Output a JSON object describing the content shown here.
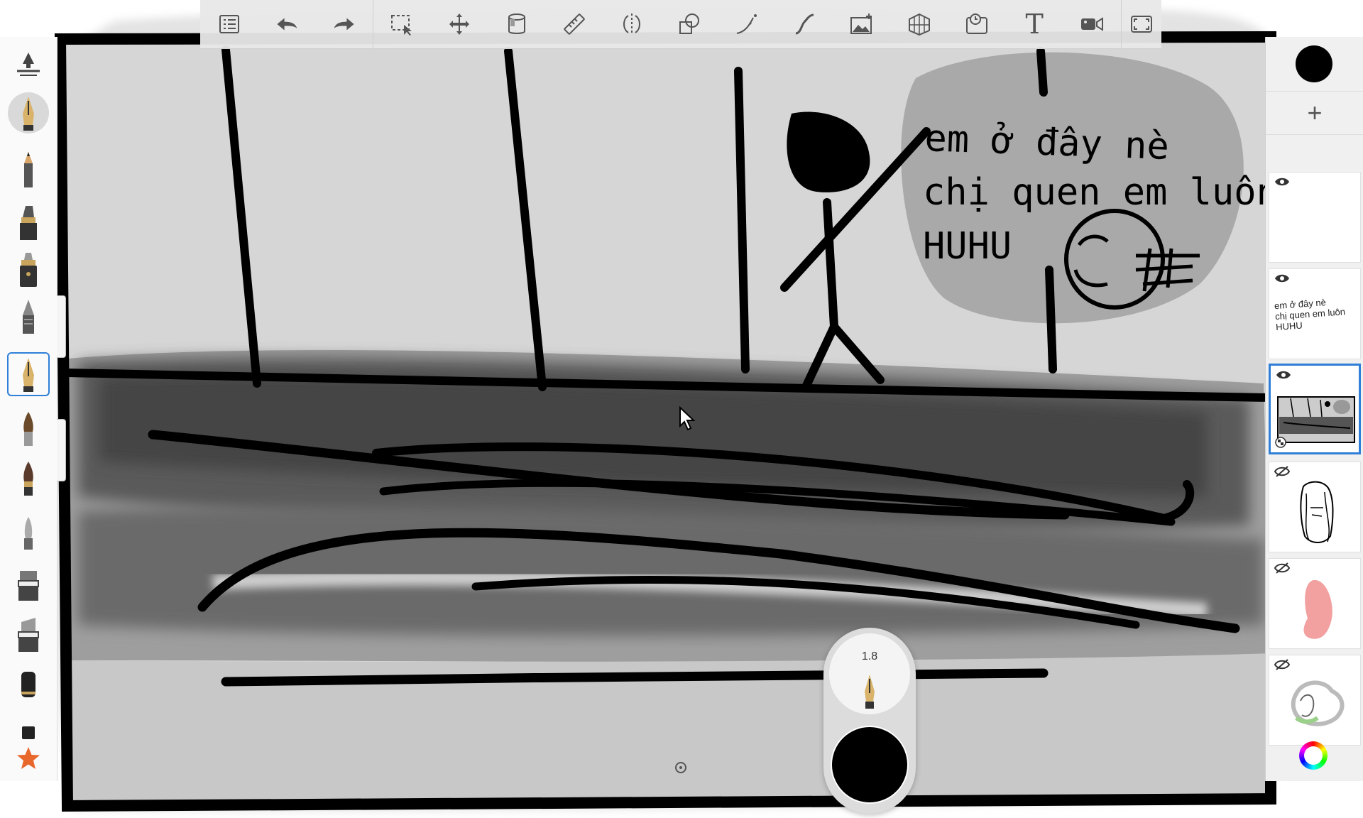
{
  "app": {
    "canvas_text": {
      "line1": "em ở đây nè",
      "line2": "chị quen em luôn",
      "line3": "HUHU"
    }
  },
  "toolbar": {
    "items": [
      {
        "name": "menu-list-icon"
      },
      {
        "name": "undo-icon"
      },
      {
        "name": "redo-icon"
      },
      {
        "name": "selection-icon"
      },
      {
        "name": "transform-move-icon"
      },
      {
        "name": "fill-bucket-icon"
      },
      {
        "name": "ruler-icon"
      },
      {
        "name": "symmetry-icon"
      },
      {
        "name": "shapes-icon"
      },
      {
        "name": "curve-icon"
      },
      {
        "name": "stroke-icon"
      },
      {
        "name": "add-image-icon"
      },
      {
        "name": "perspective-grid-icon"
      },
      {
        "name": "time-lapse-icon"
      },
      {
        "name": "text-tool-icon"
      },
      {
        "name": "record-video-icon"
      },
      {
        "name": "fullscreen-icon"
      }
    ],
    "text_tool_label": "T"
  },
  "brush_panel": {
    "selected_index": 6
  },
  "layers_panel": {
    "add_label": "+",
    "color": "#000000",
    "layers": [
      {
        "name": "layer-1",
        "visible": true,
        "type": "empty"
      },
      {
        "name": "layer-2",
        "visible": true,
        "type": "text",
        "text_lines": [
          "em ở đây nè",
          "chị quen em luôn",
          "HUHU"
        ]
      },
      {
        "name": "layer-3",
        "visible": true,
        "type": "scene",
        "selected": true
      },
      {
        "name": "layer-4",
        "visible": false,
        "type": "face"
      },
      {
        "name": "layer-5",
        "visible": false,
        "type": "pink-shape"
      },
      {
        "name": "layer-6",
        "visible": false,
        "type": "sketch"
      }
    ]
  },
  "brush_puck": {
    "size": "1.8",
    "color": "#000000"
  },
  "colors": {
    "accent": "#2f7fd8",
    "ink": "#000000"
  }
}
